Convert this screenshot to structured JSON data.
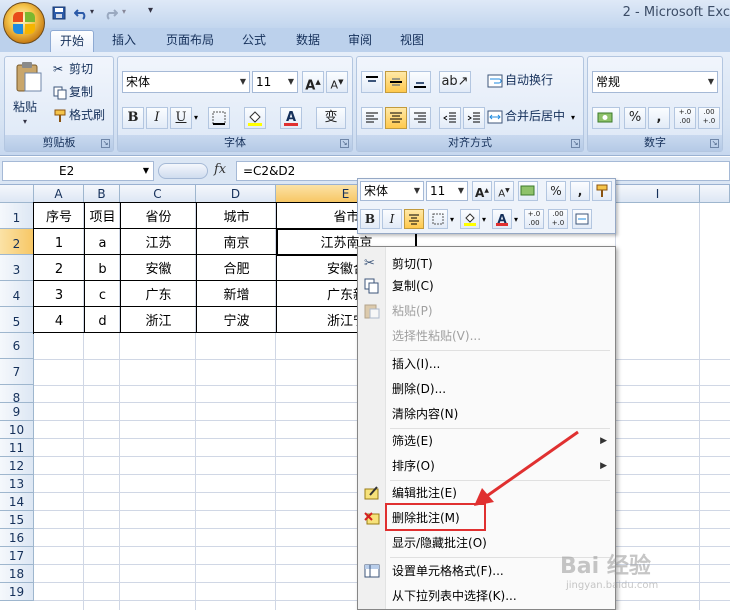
{
  "window": {
    "title": "2 - Microsoft Exc",
    "qat": {
      "save_icon": "save-icon",
      "undo_icon": "undo-icon",
      "redo_icon": "redo-icon",
      "customize": "▾"
    }
  },
  "tabs": [
    {
      "label": "开始",
      "active": true
    },
    {
      "label": "插入"
    },
    {
      "label": "页面布局"
    },
    {
      "label": "公式"
    },
    {
      "label": "数据"
    },
    {
      "label": "审阅"
    },
    {
      "label": "视图"
    }
  ],
  "ribbon": {
    "clipboard": {
      "paste": "粘贴",
      "cut": "剪切",
      "copy": "复制",
      "format_painter": "格式刷",
      "label": "剪贴板"
    },
    "font": {
      "name": "宋体",
      "size": "11",
      "label": "字体",
      "bold": "B",
      "italic": "I",
      "underline": "U",
      "grow": "A",
      "shrink": "A",
      "phonetic": "变"
    },
    "alignment": {
      "wrap_text": "自动换行",
      "merge_center": "合并后居中",
      "label": "对齐方式"
    },
    "number": {
      "format": "常规",
      "percent": "%",
      "comma": ",",
      "inc_decimal": "+.0 .00",
      "dec_decimal": ".00 +.0",
      "label": "数字"
    }
  },
  "formula_bar": {
    "name_box": "E2",
    "fx": "fx",
    "formula": "=C2&D2"
  },
  "grid": {
    "columns": [
      "A",
      "B",
      "C",
      "D",
      "E",
      "I"
    ],
    "rows": [
      "1",
      "2",
      "3",
      "4",
      "5",
      "6",
      "7",
      "8",
      "9",
      "10",
      "11",
      "12",
      "13",
      "14",
      "15",
      "16",
      "17",
      "18",
      "19"
    ],
    "table": [
      [
        "序号",
        "项目",
        "省份",
        "城市",
        "省市"
      ],
      [
        "1",
        "a",
        "江苏",
        "南京",
        "江苏南京"
      ],
      [
        "2",
        "b",
        "安徽",
        "合肥",
        "安徽合"
      ],
      [
        "3",
        "c",
        "广东",
        "新增",
        "广东新"
      ],
      [
        "4",
        "d",
        "浙江",
        "宁波",
        "浙江宁"
      ]
    ],
    "active_cell": "E2"
  },
  "mini_toolbar": {
    "font": "宋体",
    "size": "11",
    "percent": "%",
    "comma": ",",
    "bold": "B",
    "italic": "I",
    "font_color": "A"
  },
  "context_menu": [
    {
      "label": "剪切(T)",
      "icon": "scissors-icon"
    },
    {
      "label": "复制(C)",
      "icon": "copy-icon"
    },
    {
      "label": "粘贴(P)",
      "icon": "paste-icon",
      "disabled": true
    },
    {
      "label": "选择性粘贴(V)...",
      "disabled": true
    },
    {
      "label": "插入(I)..."
    },
    {
      "label": "删除(D)..."
    },
    {
      "label": "清除内容(N)"
    },
    {
      "label": "筛选(E)",
      "submenu": true
    },
    {
      "label": "排序(O)",
      "submenu": true
    },
    {
      "label": "编辑批注(E)",
      "icon": "edit-comment-icon"
    },
    {
      "label": "删除批注(M)",
      "icon": "delete-comment-icon",
      "highlighted": true
    },
    {
      "label": "显示/隐藏批注(O)"
    },
    {
      "label": "设置单元格格式(F)...",
      "icon": "format-cells-icon"
    },
    {
      "label": "从下拉列表中选择(K)..."
    }
  ],
  "watermark": {
    "text": "Bai 经验",
    "sub": "jingyan.baidu.com"
  },
  "colors": {
    "accent": "#f7c765",
    "annotation": "#e03030"
  }
}
